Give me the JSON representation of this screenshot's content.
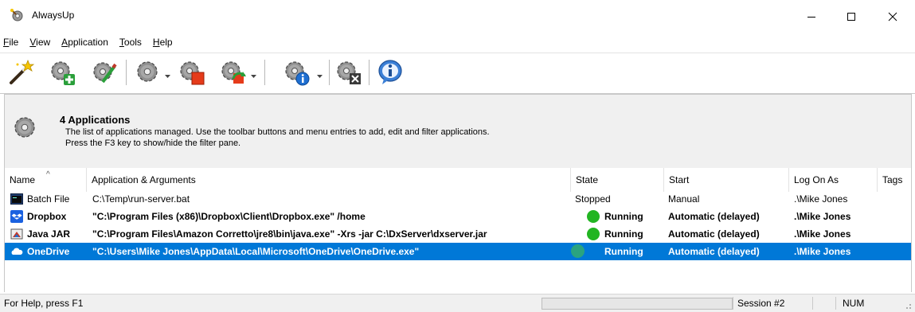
{
  "window": {
    "title": "AlwaysUp",
    "minimize": "─",
    "maximize": "☐",
    "close": "✕"
  },
  "menu": [
    {
      "accel": "F",
      "rest": "ile"
    },
    {
      "accel": "V",
      "rest": "iew"
    },
    {
      "accel": "A",
      "rest": "pplication"
    },
    {
      "accel": "T",
      "rest": "ools"
    },
    {
      "accel": "H",
      "rest": "elp"
    }
  ],
  "toolbar": {
    "buttons": [
      "wizard-icon",
      "add-application-icon",
      "edit-application-icon",
      "start-application-icon",
      "stop-application-icon",
      "restart-application-icon",
      "report-application-icon",
      "remove-application-icon",
      "about-icon"
    ]
  },
  "info": {
    "title": "4 Applications",
    "line1": "The list of applications managed. Use the toolbar buttons and menu entries to add, edit and filter applications.",
    "line2": "Press the F3 key to show/hide the filter pane."
  },
  "table": {
    "columns": [
      "Name",
      "Application & Arguments",
      "State",
      "Start",
      "Log On As",
      "Tags"
    ],
    "rows": [
      {
        "name": "Batch File",
        "app": "C:\\Temp\\run-server.bat",
        "state": "Stopped",
        "start": "Manual",
        "logon": ".\\Mike Jones",
        "tags": ""
      },
      {
        "name": "Dropbox",
        "app": "\"C:\\Program Files (x86)\\Dropbox\\Client\\Dropbox.exe\" /home",
        "state": "Running",
        "start": "Automatic (delayed)",
        "logon": ".\\Mike Jones",
        "tags": ""
      },
      {
        "name": "Java JAR",
        "app": "\"C:\\Program Files\\Amazon Corretto\\jre8\\bin\\java.exe\" -Xrs -jar C:\\DxServer\\dxserver.jar",
        "state": "Running",
        "start": "Automatic (delayed)",
        "logon": ".\\Mike Jones",
        "tags": ""
      },
      {
        "name": "OneDrive",
        "app": "\"C:\\Users\\Mike Jones\\AppData\\Local\\Microsoft\\OneDrive\\OneDrive.exe\"",
        "state": "Running",
        "start": "Automatic (delayed)",
        "logon": ".\\Mike Jones",
        "tags": ""
      }
    ]
  },
  "statusbar": {
    "help": "For Help, press F1",
    "session": "Session #2",
    "num": "NUM"
  },
  "colors": {
    "selection": "#0078d7",
    "running": "#22b522",
    "running_selected": "#2aa37f"
  }
}
